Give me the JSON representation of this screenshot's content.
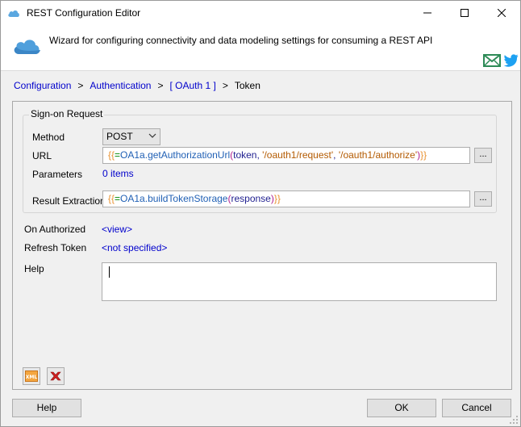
{
  "window": {
    "title": "REST Configuration Editor",
    "controls": {
      "minimize": "minimize",
      "maximize": "maximize",
      "close": "close"
    }
  },
  "banner": {
    "description": "Wizard for configuring connectivity and data modeling settings for consuming a REST API",
    "icons": [
      "cloud-icon",
      "mail-icon",
      "twitter-icon"
    ]
  },
  "breadcrumb": {
    "items": [
      "Configuration",
      "Authentication",
      "[ OAuth 1 ]"
    ],
    "separator": ">",
    "current": "Token"
  },
  "signon": {
    "group_title": "Sign-on Request",
    "method_label": "Method",
    "method_value": "POST",
    "url_label": "URL",
    "url_expr": {
      "open": "{{",
      "op": "=",
      "obj": "OA1a",
      "dot": ".",
      "fn": "getAuthorizationUrl",
      "paren_open": "(",
      "arg1": "token",
      "comma1": ", ",
      "arg2": "'/oauth1/request'",
      "comma2": ", ",
      "arg3": "'/oauth1/authorize'",
      "paren_close": ")",
      "close": "}}"
    },
    "parameters_label": "Parameters",
    "parameters_value": "0 items",
    "result_label": "Result Extraction",
    "result_expr": {
      "open": "{{",
      "op": "=",
      "obj": "OA1a",
      "dot": ".",
      "fn": "buildTokenStorage",
      "paren_open": "(",
      "arg1": "response",
      "paren_close": ")",
      "close": "}}"
    },
    "browse_label": "..."
  },
  "on_authorized": {
    "label": "On Authorized",
    "value": "<view>"
  },
  "refresh_token": {
    "label": "Refresh Token",
    "value": "<not specified>"
  },
  "help": {
    "label": "Help",
    "value": ""
  },
  "tools": {
    "xml_label": "XML"
  },
  "buttons": {
    "help": "Help",
    "ok": "OK",
    "cancel": "Cancel"
  },
  "colors": {
    "link": "#0000cc",
    "brace": "#e8912f",
    "function": "#1f5fb4",
    "string": "#b35a00",
    "mail": "#2e8b57",
    "twitter": "#1da1f2",
    "delete": "#d42020"
  }
}
